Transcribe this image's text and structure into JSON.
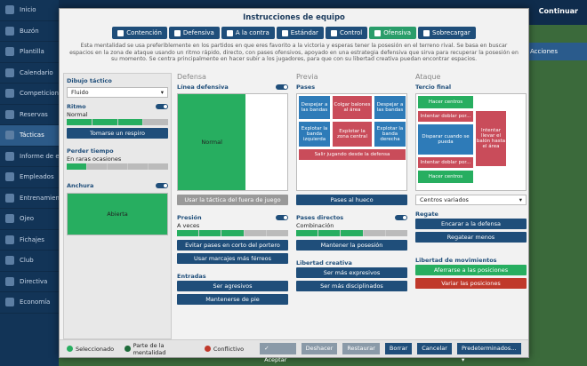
{
  "sidebar": {
    "items": [
      "Inicio",
      "Buzón",
      "Plantilla",
      "Calendario",
      "Competiciones",
      "Reservas",
      "Tácticas",
      "Informe de equipo",
      "Empleados",
      "Entrenamiento",
      "Ojeo",
      "Fichajes",
      "Club",
      "Directiva",
      "Economía"
    ]
  },
  "topbar": {
    "continue": "Continuar"
  },
  "bg": {
    "actions": "Acciones"
  },
  "modal": {
    "title": "Instrucciones de equipo",
    "tabs": [
      "Contención",
      "Defensiva",
      "A la contra",
      "Estándar",
      "Control",
      "Ofensiva",
      "Sobrecargar"
    ],
    "desc": "Esta mentalidad se usa preferiblemente en los partidos en que eres favorito a la victoria y esperas tener la posesión en el terreno rival. Se basa en buscar espacios en la zona de ataque usando un ritmo rápido, directo, con pases ofensivos, apoyado en una estrategia defensiva que sirva para recuperar la posesión en su momento. Se centra principalmente en hacer subir a los jugadores, para que con su libertad creativa puedan encontrar espacios."
  },
  "left": {
    "dibujo": "Dibujo táctico",
    "formation": "Fluido",
    "ritmo": "Ritmo",
    "ritmo_val": "Normal",
    "ritmo_btn": "Tomarse un respiro",
    "perder": "Perder tiempo",
    "perder_val": "En raras ocasiones",
    "anchura": "Anchura",
    "anchura_val": "Abierta"
  },
  "defensa": {
    "head": "Defensa",
    "linea": "Línea defensiva",
    "pitch_label": "Normal",
    "offside": "Usar la táctica del fuera de juego",
    "presion": "Presión",
    "presion_val": "A veces",
    "b1": "Evitar pases en corto del portero",
    "b2": "Usar marcajes más férreos",
    "entradas": "Entradas",
    "b3": "Ser agresivos",
    "b4": "Mantenerse de pie"
  },
  "previa": {
    "head": "Previa",
    "pases": "Pases",
    "z1": "Despejar a las bandas",
    "z2": "Colgar balones al área",
    "z3": "Despejar a las bandas",
    "z4": "Explotar la banda izquierda",
    "z5": "Explotar la zona central",
    "z6": "Explotar la banda derecha",
    "z7": "Salir jugando desde la defensa",
    "b1": "Pases al hueco",
    "directos": "Pases directos",
    "directos_val": "Combinación",
    "b2": "Mantener la posesión",
    "libertad": "Libertad creativa",
    "b3": "Ser más expresivos",
    "b4": "Ser más disciplinados"
  },
  "ataque": {
    "head": "Ataque",
    "tercio": "Tercio final",
    "z1": "Hacer centros",
    "z2": "Intentar doblar por...",
    "z3": "Disparar cuando se pueda",
    "z4": "Intentar llevar el balón hasta el área",
    "z5": "Intentar doblar por...",
    "z6": "Hacer centros",
    "centros_sel": "Centros variados",
    "regate": "Regate",
    "b1": "Encarar a la defensa",
    "b2": "Regatear menos",
    "movimientos": "Libertad de movimientos",
    "b3": "Aferrarse a las posiciones",
    "b4": "Variar las posiciones"
  },
  "footer": {
    "l1": "Seleccionado",
    "l2": "Parte de la mentalidad",
    "l3": "Conflictivo",
    "accept": "Aceptar",
    "undo": "Deshacer",
    "restore": "Restaurar",
    "clear": "Borrar",
    "cancel": "Cancelar",
    "presets": "Predeterminados..."
  },
  "colors": {
    "selected": "#27ae60",
    "mentality": "#1e6b3a",
    "conflict": "#c0392b",
    "primary": "#1f4e7a"
  }
}
